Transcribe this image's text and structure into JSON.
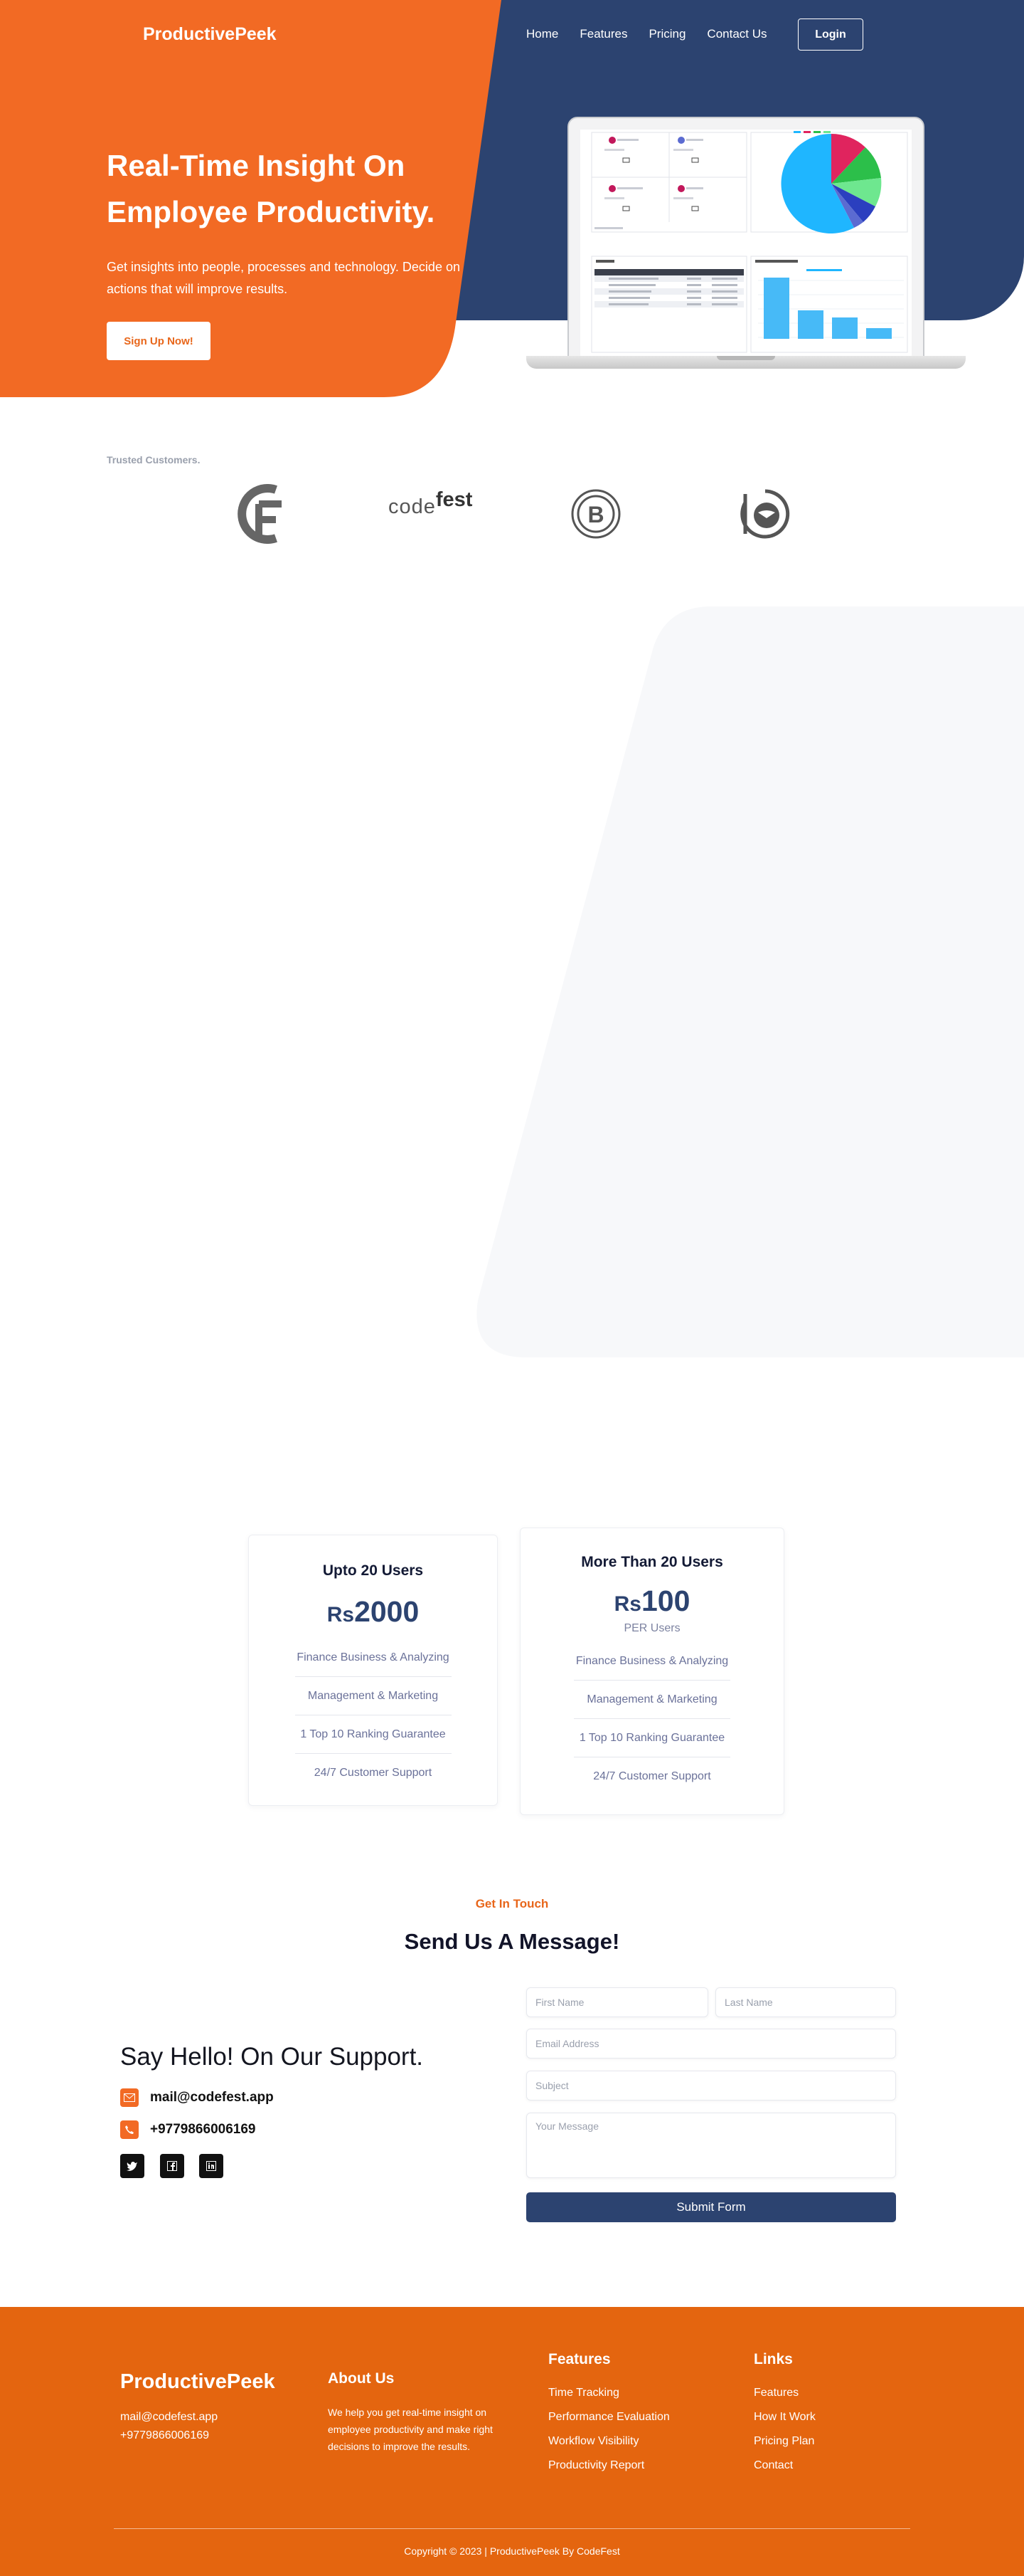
{
  "nav": {
    "brand": "ProductivePeek",
    "links": [
      "Home",
      "Features",
      "Pricing",
      "Contact Us"
    ],
    "login": "Login"
  },
  "hero": {
    "title": "Real-Time Insight On Employee Productivity.",
    "subtitle": "Get insights into people, processes and technology. Decide on actions that will improve results.",
    "cta": "Sign Up Now!"
  },
  "trusted": {
    "label": "Trusted Customers.",
    "logos": [
      "fc-logo",
      "codefest-logo",
      "b-logo",
      "bird-logo"
    ],
    "codefest_text_a": "code",
    "codefest_text_b": "fest"
  },
  "pricing": {
    "plans": [
      {
        "name": "Upto 20 Users",
        "currency": "Rs",
        "amount": "2000",
        "per": "",
        "features": [
          "Finance Business & Analyzing",
          "Management & Marketing",
          "1 Top 10 Ranking Guarantee",
          "24/7 Customer Support"
        ]
      },
      {
        "name": "More Than 20 Users",
        "currency": "Rs",
        "amount": "100",
        "per": "PER Users",
        "features": [
          "Finance Business & Analyzing",
          "Management & Marketing",
          "1 Top 10 Ranking Guarantee",
          "24/7 Customer Support"
        ]
      }
    ]
  },
  "contact": {
    "eyebrow": "Get In Touch",
    "title": "Send Us A Message!",
    "hello": "Say Hello! On Our Support.",
    "email": "mail@codefest.app",
    "phone": "+9779866006169",
    "socials": [
      "twitter-icon",
      "facebook-icon",
      "linkedin-icon"
    ],
    "form": {
      "first_name": "First Name",
      "last_name": "Last Name",
      "email": "Email Address",
      "subject": "Subject",
      "message": "Your Message",
      "submit": "Submit Form"
    }
  },
  "footer": {
    "brand": "ProductivePeek",
    "email": "mail@codefest.app",
    "phone": "+9779866006169",
    "about_title": "About Us",
    "about_text": "We help you get real-time insight on employee productivity and make right decisions to improve the results.",
    "features_title": "Features",
    "features": [
      "Time Tracking",
      "Performance Evaluation",
      "Workflow Visibility",
      "Productivity Report"
    ],
    "links_title": "Links",
    "links": [
      "Features",
      "How It Work",
      "Pricing Plan",
      "Contact"
    ],
    "copyright": "Copyright © 2023 | ProductivePeek By CodeFest"
  },
  "colors": {
    "navy": "#2c4370",
    "orange": "#f26a24",
    "footer_orange": "#e4650f"
  }
}
